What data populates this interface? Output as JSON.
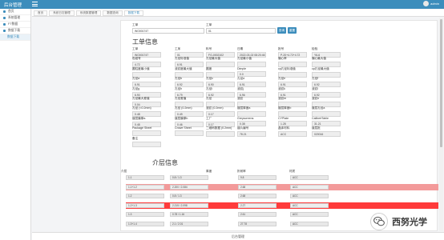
{
  "header": {
    "brand": "后台管理",
    "user": "admin"
  },
  "sidebar": {
    "items": [
      "首页",
      "系统管理",
      "FT数据",
      "数据下载",
      "数据下载"
    ]
  },
  "tabs": [
    "首页",
    "系统日志管理",
    "系统数据管理",
    "数据查询",
    "数据下载"
  ],
  "search": {
    "label1": "工单",
    "value1": "WO001747",
    "label2": "工单",
    "value2": "01",
    "btn_search": "查询",
    "btn_reset": "重置"
  },
  "workorder": {
    "title": "工单信息",
    "fields": [
      {
        "label": "工单",
        "value": "WO001747"
      },
      {
        "label": "工序",
        "value": "01"
      },
      {
        "label": "料号",
        "value": "FG-0002102"
      },
      {
        "label": "日期",
        "value": "2022-03-02 08:20:46"
      },
      {
        "label": "批号",
        "value": "P-20+4.72+4.72"
      },
      {
        "label": "检验",
        "value": "Y6-6"
      },
      {
        "label": "色组号",
        "value": "4.72"
      },
      {
        "label": "孔径标准值",
        "value": "6.91"
      },
      {
        "label": "孔径最大值",
        "value": ""
      },
      {
        "label": "孔径最小值",
        "value": ""
      },
      {
        "label": "偏心率",
        "value": ""
      },
      {
        "label": "偏心最大值",
        "value": ""
      },
      {
        "label": "圆柱度最小值",
        "value": ""
      },
      {
        "label": "波纹度最大值",
        "value": ""
      },
      {
        "label": "圆度",
        "value": ""
      },
      {
        "label": "Dimple",
        "value": "0.0"
      },
      {
        "label": "cp孔径标准值",
        "value": ""
      },
      {
        "label": "cp孔径最大值",
        "value": ""
      },
      {
        "label": "孔径a",
        "value": "6.91"
      },
      {
        "label": "孔径b",
        "value": "6.92"
      },
      {
        "label": "孔径c",
        "value": "6.90"
      },
      {
        "label": "孔径d",
        "value": "6.91"
      },
      {
        "label": "孔径e",
        "value": "6.91"
      },
      {
        "label": "孔径f",
        "value": "6.92"
      },
      {
        "label": "孔径g",
        "value": "6.90"
      },
      {
        "label": "孔径h",
        "value": "6.79"
      },
      {
        "label": "孔径i",
        "value": "6.92"
      },
      {
        "label": "波纹j",
        "value": "6.96"
      },
      {
        "label": "波纹k",
        "value": "6.91"
      },
      {
        "label": "波纹l",
        "value": "6.92"
      },
      {
        "label": "孔径最大差值",
        "value": "0.04"
      },
      {
        "label": "孔径差值",
        "value": ""
      },
      {
        "label": "孔径",
        "value": ""
      },
      {
        "label": "波纹",
        "value": ""
      },
      {
        "label": "波纹m",
        "value": ""
      },
      {
        "label": "波纹n",
        "value": ""
      },
      {
        "label": "孔径 (<0.2mm)",
        "value": "0.48"
      },
      {
        "label": "孔径 (0.2mm)",
        "value": "0.49"
      },
      {
        "label": "波纹 (0.2mm)",
        "value": "0.17"
      },
      {
        "label": "镀层厚度a",
        "value": ""
      },
      {
        "label": "镀层厚度b",
        "value": ""
      },
      {
        "label": "镀层孔径a",
        "value": ""
      },
      {
        "label": "镀层膜厚a",
        "value": "0.48"
      },
      {
        "label": "镀层膜厚b",
        "value": "0.46"
      },
      {
        "label": "工厂",
        "value": "0.17"
      },
      {
        "label": "Greyscreens",
        "value": "0.38"
      },
      {
        "label": "CYPlate",
        "value": "1.28"
      },
      {
        "label": "CalibertTable",
        "value": "31.21"
      },
      {
        "label": "Package Sheet",
        "value": ""
      },
      {
        "label": "Crowe Sheet",
        "value": ""
      },
      {
        "label": "二维码数据 (0.2mm)",
        "value": ""
      },
      {
        "label": "镀片编号",
        "value": "78.21"
      },
      {
        "label": "晶体材料",
        "value": "ACC"
      },
      {
        "label": "镀层批",
        "value": "020016"
      },
      {
        "label": "备注",
        "value": ""
      }
    ]
  },
  "media": {
    "title": "介层信息",
    "headers": [
      "介层",
      "厚度",
      "折射率",
      "材质"
    ],
    "rows": [
      {
        "c1": "1.1",
        "c2": "0.8 / 1.3",
        "c3": "9.8",
        "c4": "ACC",
        "hl": ""
      },
      {
        "c1": "1.1+1.2",
        "c2": "2.200 / 2.084",
        "c3": "2.68",
        "c4": "ACC",
        "hl": "red"
      },
      {
        "c1": "1.2",
        "c2": "0.8 / 1.3",
        "c3": "2.68",
        "c4": "ACC",
        "hl": ""
      },
      {
        "c1": "1.2+1.3",
        "c2": "2.215 / 2.098",
        "c3": "2.27",
        "c4": "ACC",
        "hl": "red2"
      },
      {
        "c1": "1.3",
        "c2": "0.78 / 1.16",
        "c3": "2.61",
        "c4": "ACC",
        "hl": ""
      },
      {
        "c1": "1.3+1.4",
        "c2": "2.1 / 2.01",
        "c3": "27.78",
        "c4": "ACC",
        "hl": ""
      }
    ]
  },
  "footer": "后台管理",
  "watermark": "西努光学"
}
